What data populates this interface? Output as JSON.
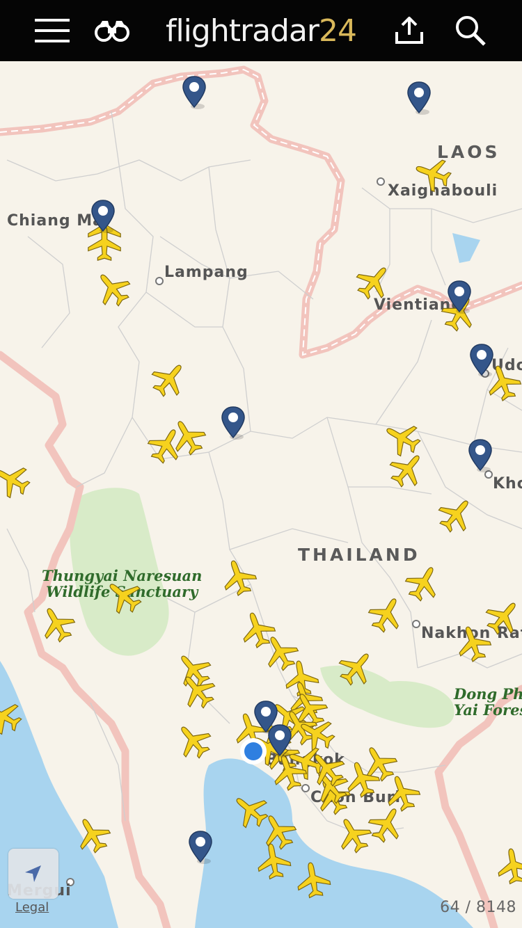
{
  "header": {
    "brand_main": "flightradar",
    "brand_num": "24",
    "menu_icon": "hamburger-menu-icon",
    "binoculars_icon": "binoculars-icon",
    "share_icon": "share-icon",
    "search_icon": "search-icon"
  },
  "map": {
    "countries": {
      "laos": "LAOS",
      "thailand": "THAILAND"
    },
    "cities": {
      "chiang_mai": "Chiang Mai",
      "lampang": "Lampang",
      "xaignabouli": "Xaignabouli",
      "vientiane": "Vientiane",
      "udon": "Udo",
      "khon": "Kho",
      "nakhon": "Nakhon Rat",
      "bangkok": "Bangkok",
      "chon_buri": "Chon Buri",
      "mergui": "Mergui"
    },
    "parks": {
      "thungyai_1": "Thungyai Naresuan",
      "thungyai_2": "Wildlife Sanctuary",
      "dong_1": "Dong Pha",
      "dong_2": "Yai Forest"
    },
    "colors": {
      "land": "#f7f3ea",
      "water": "#a8d4ef",
      "border": "#f2c4bd",
      "park": "#d8ebc8",
      "plane": "#f6d21e",
      "pin": "#34568a"
    }
  },
  "footer": {
    "legal": "Legal",
    "aircraft_count": "64 / 8148",
    "locate_icon": "location-arrow-icon"
  }
}
